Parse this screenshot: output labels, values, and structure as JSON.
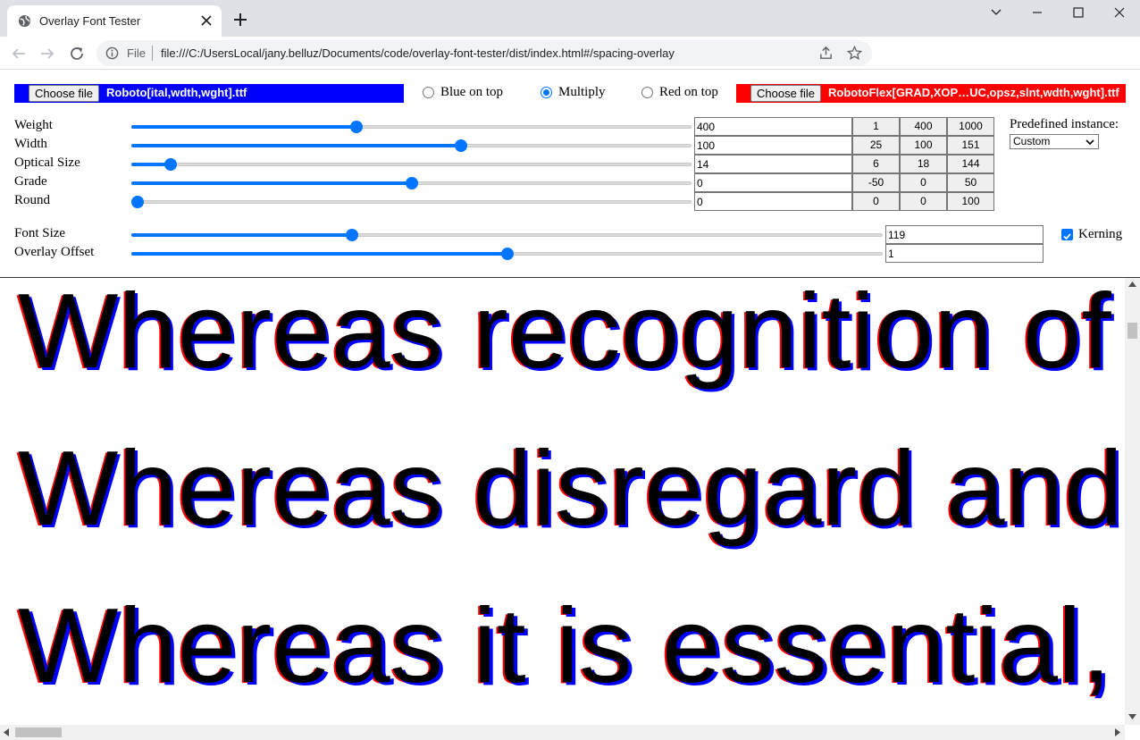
{
  "browser": {
    "tab_title": "Overlay Font Tester",
    "url_scheme": "File",
    "url": "file:///C:/UsersLocal/jany.belluz/Documents/code/overlay-font-tester/dist/index.html#/spacing-overlay"
  },
  "files": {
    "choose_label": "Choose file",
    "blue_file": "Roboto[ital,wdth,wght].ttf",
    "red_file": "RobotoFlex[GRAD,XOP…UC,opsz,slnt,wdth,wght].ttf",
    "blue_color": "#0000ff",
    "red_color": "#ff0000"
  },
  "blend_modes": [
    {
      "label": "Blue on top",
      "checked": false
    },
    {
      "label": "Multiply",
      "checked": true
    },
    {
      "label": "Red on top",
      "checked": false
    }
  ],
  "axes": [
    {
      "label": "Weight",
      "value": "400",
      "fraction": 0.4,
      "presets": [
        "1",
        "400",
        "1000"
      ]
    },
    {
      "label": "Width",
      "value": "100",
      "fraction": 0.59,
      "presets": [
        "25",
        "100",
        "151"
      ]
    },
    {
      "label": "Optical Size",
      "value": "14",
      "fraction": 0.06,
      "presets": [
        "6",
        "18",
        "144"
      ]
    },
    {
      "label": "Grade",
      "value": "0",
      "fraction": 0.5,
      "presets": [
        "-50",
        "0",
        "50"
      ]
    },
    {
      "label": "Round",
      "value": "0",
      "fraction": 0.0,
      "presets": [
        "0",
        "0",
        "100"
      ]
    }
  ],
  "predefined": {
    "label": "Predefined instance:",
    "selected": "Custom"
  },
  "font_size": {
    "label": "Font Size",
    "value": "119",
    "fraction": 0.29
  },
  "overlay_offset": {
    "label": "Overlay Offset",
    "value": "1",
    "fraction": 0.5
  },
  "kerning": {
    "label": "Kerning",
    "checked": true
  },
  "preview_lines": [
    "Whereas recognition of",
    "Whereas disregard and",
    "Whereas it is essential,"
  ]
}
